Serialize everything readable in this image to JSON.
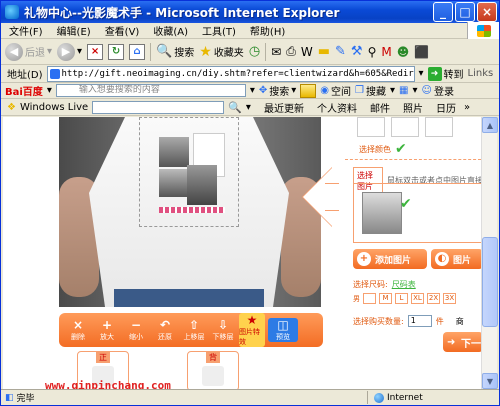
{
  "window": {
    "title": "礼物中心--光影魔术手 - Microsoft Internet Explorer",
    "buttons": {
      "minimize": "_",
      "maximize": "□",
      "close": "×"
    }
  },
  "menu": [
    "文件(F)",
    "编辑(E)",
    "查看(V)",
    "收藏(A)",
    "工具(T)",
    "帮助(H)"
  ],
  "toolbar": {
    "back": "后退",
    "search": "搜索",
    "favorites": "收藏夹"
  },
  "address": {
    "label": "地址(D)",
    "url": "http://gift.neoimaging.cn/diy.shtm?refer=clientwizard&h=605&RedirectUrl=htt",
    "go": "转到",
    "links": "Links"
  },
  "baidu": {
    "logo": "Bai百度",
    "placeholder": "输入想要搜索的内容",
    "search": "搜索",
    "space": "空间",
    "search2": "搜藏",
    "login": "登录"
  },
  "live": {
    "brand": "Windows Live",
    "links": [
      "最近更新",
      "个人资料",
      "邮件",
      "照片",
      "日历"
    ]
  },
  "editor": {
    "tools": [
      {
        "icon": "×",
        "label": "删除"
      },
      {
        "icon": "+",
        "label": "放大"
      },
      {
        "icon": "−",
        "label": "缩小"
      },
      {
        "icon": "↶",
        "label": "还原"
      },
      {
        "icon": "⇧",
        "label": "上移层"
      },
      {
        "icon": "⇩",
        "label": "下移层"
      },
      {
        "icon": "★",
        "label": "图片特效"
      },
      {
        "icon": "◫",
        "label": "预览"
      }
    ],
    "front_label": "正",
    "back_label": "背"
  },
  "panel": {
    "select_color": "选择颜色",
    "tab_select": "选择图片",
    "tab_hint": "鼠标双击或者点中图片直接",
    "add_image": "添加图片",
    "image_btn": "图片",
    "select_size": "选择尺码:",
    "size_chart": "尺码表",
    "gender": "男",
    "sizes": [
      "M",
      "L",
      "XL",
      "2X",
      "3X"
    ],
    "qty_label": "选择购买数量:",
    "qty_value": "1",
    "qty_unit": "件",
    "extra": "商",
    "next": "下一"
  },
  "watermark": "www.qinpinchang.com",
  "status": {
    "left": "完毕",
    "zone": "Internet"
  },
  "colors": {
    "accent": "#f36d24",
    "xp_blue": "#0a4ad6"
  }
}
